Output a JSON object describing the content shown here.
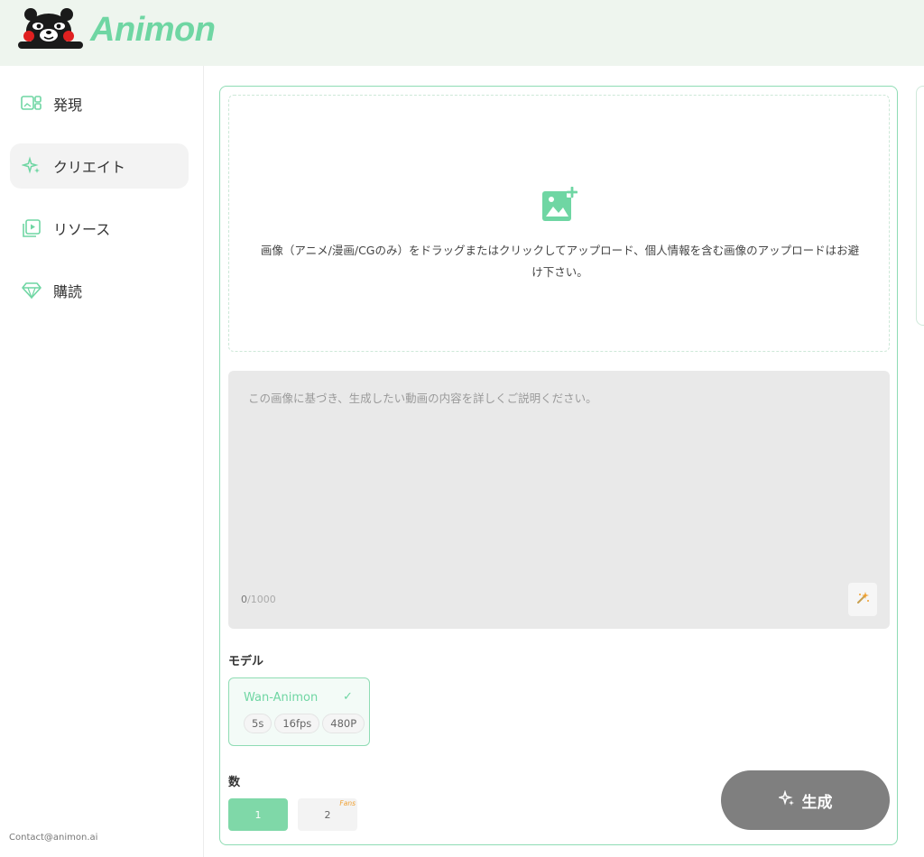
{
  "app": {
    "name": "Animon"
  },
  "sidebar": {
    "items": [
      {
        "label": "発現",
        "icon": "gallery-icon",
        "active": false
      },
      {
        "label": "クリエイト",
        "icon": "sparkle-icon",
        "active": true
      },
      {
        "label": "リソース",
        "icon": "video-library-icon",
        "active": false
      },
      {
        "label": "購読",
        "icon": "diamond-icon",
        "active": false
      }
    ],
    "contact": "Contact@animon.ai"
  },
  "upload": {
    "text": "画像（アニメ/漫画/CGのみ）をドラッグまたはクリックしてアップロード、個人情報を含む画像のアップロードはお避け下さい。",
    "icon": "add-image-icon"
  },
  "prompt": {
    "placeholder": "この画像に基づき、生成したい動画の内容を詳しくご説明ください。",
    "count": "0",
    "max": "/1000"
  },
  "model": {
    "label": "モデル",
    "name": "Wan-Animon",
    "check": "✓",
    "tags": [
      "5s",
      "16fps",
      "480P"
    ]
  },
  "quantity": {
    "label": "数",
    "options": [
      {
        "value": "1",
        "selected": true
      },
      {
        "value": "2",
        "badge": "Fans"
      }
    ]
  },
  "generate": {
    "label": "生成"
  },
  "colors": {
    "accent": "#6fd6a3",
    "header_bg": "#eef5ee",
    "button_gray": "#7f7f7f"
  }
}
